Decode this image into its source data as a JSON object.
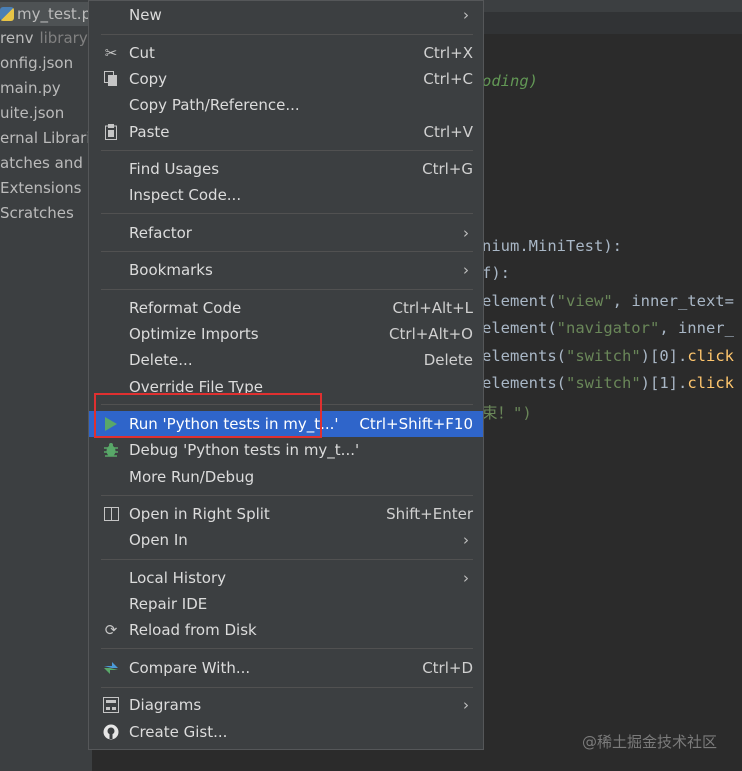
{
  "project_tree": {
    "tab_label": "my_test.p",
    "rows": [
      {
        "label": "renv",
        "dim": "library r"
      },
      {
        "label": "onfig.json",
        "dim": ""
      },
      {
        "label": "main.py",
        "dim": ""
      },
      {
        "label": "uite.json",
        "dim": ""
      },
      {
        "label": "ernal Librarie",
        "dim": ""
      },
      {
        "label": "atches and C",
        "dim": ""
      },
      {
        "label": "Extensions",
        "dim": ""
      },
      {
        "label": "Scratches",
        "dim": ""
      }
    ]
  },
  "editor": {
    "lines": {
      "l1": "oding)",
      "l2": "nium.MiniTest):",
      "l3": "f):",
      "l4_a": "element(",
      "l4_s": "\"view\"",
      "l4_b": ", inner_text=",
      "l5_a": "element(",
      "l5_s": "\"navigator\"",
      "l5_b": ", inner_",
      "l6_a": "elements(",
      "l6_s": "\"switch\"",
      "l6_b": ")[0].",
      "l6_f": "click",
      "l7_a": "elements(",
      "l7_s": "\"switch\"",
      "l7_b": ")[1].",
      "l7_f": "click",
      "l8": "束！\")"
    },
    "watermark": "@稀土掘金技术社区"
  },
  "menu": {
    "new": {
      "label": "New"
    },
    "cut": {
      "label": "Cut",
      "shortcut": "Ctrl+X"
    },
    "copy": {
      "label": "Copy",
      "shortcut": "Ctrl+C"
    },
    "copy_path": {
      "label": "Copy Path/Reference..."
    },
    "paste": {
      "label": "Paste",
      "shortcut": "Ctrl+V"
    },
    "find_usages": {
      "label": "Find Usages",
      "shortcut": "Ctrl+G"
    },
    "inspect_code": {
      "label": "Inspect Code..."
    },
    "refactor": {
      "label": "Refactor"
    },
    "bookmarks": {
      "label": "Bookmarks"
    },
    "reformat": {
      "label": "Reformat Code",
      "shortcut": "Ctrl+Alt+L"
    },
    "optimize": {
      "label": "Optimize Imports",
      "shortcut": "Ctrl+Alt+O"
    },
    "delete": {
      "label": "Delete...",
      "shortcut": "Delete"
    },
    "override": {
      "label": "Override File Type"
    },
    "run": {
      "label": "Run 'Python tests in my_t...'",
      "shortcut": "Ctrl+Shift+F10"
    },
    "debug": {
      "label": "Debug 'Python tests in my_t...'"
    },
    "more_run": {
      "label": "More Run/Debug"
    },
    "open_split": {
      "label": "Open in Right Split",
      "shortcut": "Shift+Enter"
    },
    "open_in": {
      "label": "Open In"
    },
    "local_history": {
      "label": "Local History"
    },
    "repair_ide": {
      "label": "Repair IDE"
    },
    "reload": {
      "label": "Reload from Disk"
    },
    "compare": {
      "label": "Compare With...",
      "shortcut": "Ctrl+D"
    },
    "diagrams": {
      "label": "Diagrams"
    },
    "gist": {
      "label": "Create Gist..."
    }
  },
  "colors": {
    "menu_bg": "#3c3f41",
    "selection": "#2f65ca",
    "highlight_box": "#e03030",
    "run_icon": "#59a869"
  },
  "icons": {
    "cut": "scissors-icon",
    "copy": "copy-icon",
    "paste": "paste-icon",
    "run": "play-icon",
    "debug": "bug-icon",
    "split": "split-icon",
    "reload": "reload-icon",
    "compare": "compare-icon",
    "diagrams": "diagram-icon",
    "gist": "github-icon",
    "submenu": "chevron-right-icon"
  }
}
